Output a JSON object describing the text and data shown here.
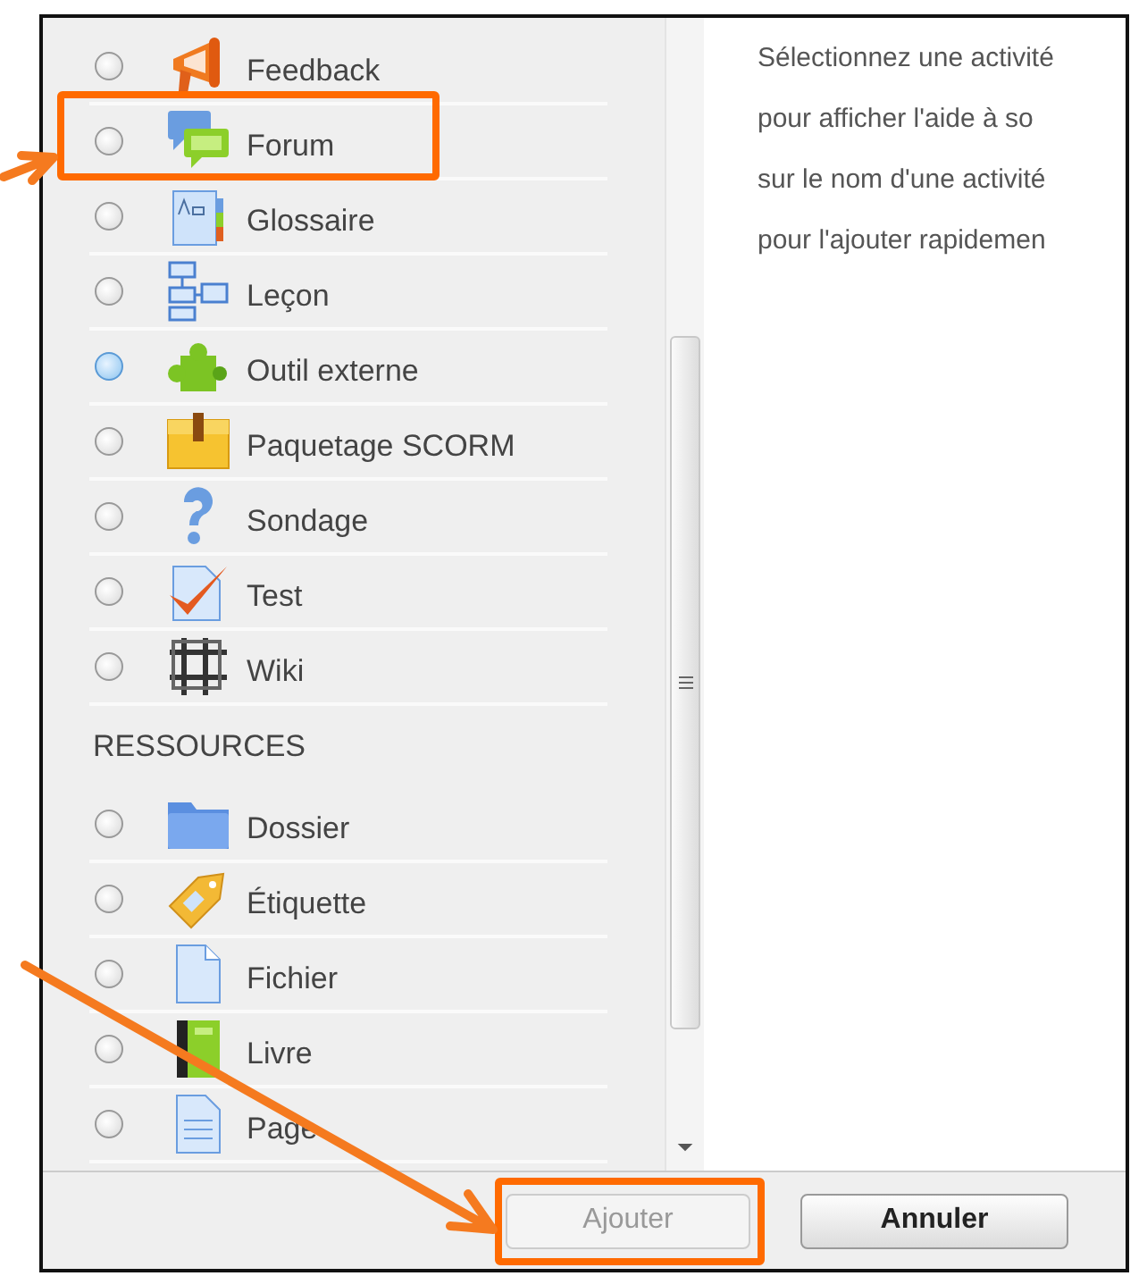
{
  "sections": [
    {
      "items": [
        {
          "label": "Feedback",
          "selected": false,
          "highlighted": false
        },
        {
          "label": "Forum",
          "selected": false,
          "highlighted": true
        },
        {
          "label": "Glossaire",
          "selected": false,
          "highlighted": false
        },
        {
          "label": "Leçon",
          "selected": false,
          "highlighted": false
        },
        {
          "label": "Outil externe",
          "selected": true,
          "highlighted": false
        },
        {
          "label": "Paquetage SCORM",
          "selected": false,
          "highlighted": false
        },
        {
          "label": "Sondage",
          "selected": false,
          "highlighted": false
        },
        {
          "label": "Test",
          "selected": false,
          "highlighted": false
        },
        {
          "label": "Wiki",
          "selected": false,
          "highlighted": false
        }
      ]
    },
    {
      "title": "RESSOURCES",
      "items": [
        {
          "label": "Dossier",
          "selected": false,
          "highlighted": false
        },
        {
          "label": "Étiquette",
          "selected": false,
          "highlighted": false
        },
        {
          "label": "Fichier",
          "selected": false,
          "highlighted": false
        },
        {
          "label": "Livre",
          "selected": false,
          "highlighted": false
        },
        {
          "label": "Page",
          "selected": false,
          "highlighted": false
        }
      ]
    }
  ],
  "help_lines": [
    "Sélectionnez une activité",
    "pour afficher l'aide à so",
    "sur le nom d'une activité",
    "pour l'ajouter rapidemen"
  ],
  "buttons": [
    {
      "label": "Ajouter",
      "disabled": true,
      "highlighted": true
    },
    {
      "label": "Annuler",
      "disabled": false,
      "highlighted": false
    }
  ]
}
